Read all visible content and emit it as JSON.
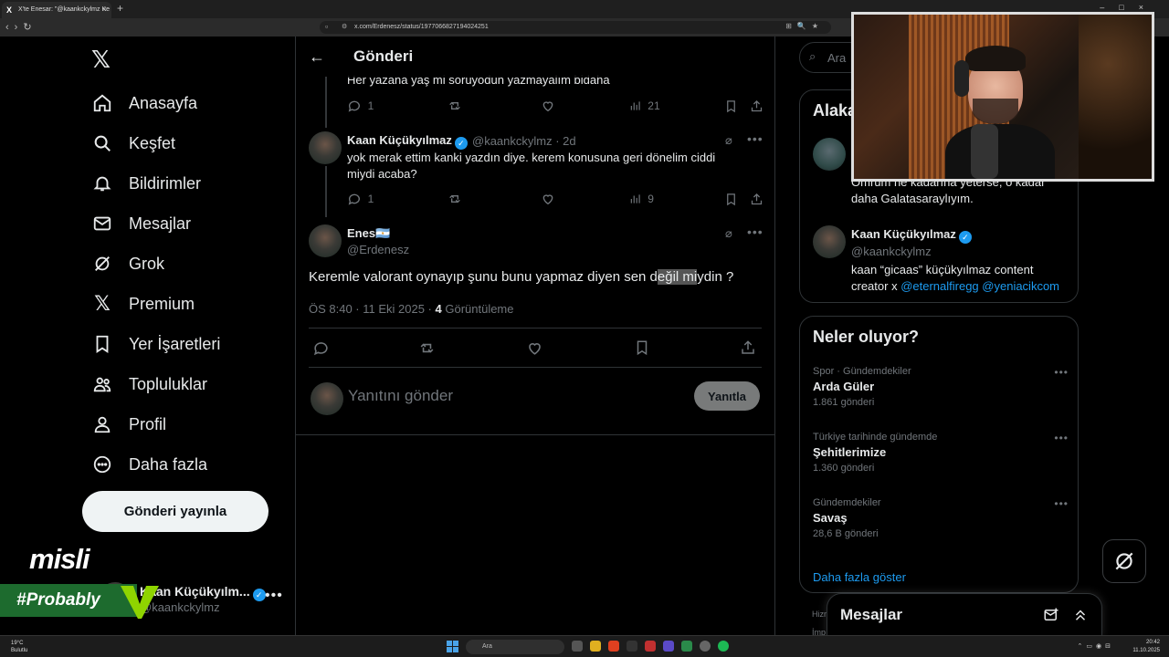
{
  "browser": {
    "tab_title": "X'te Enesar: \"@kaankckylmz Ke",
    "url": "x.com/Erdenesz/status/1977066827194024251"
  },
  "sidebar": {
    "items": [
      {
        "label": "Anasayfa",
        "icon": "home-icon"
      },
      {
        "label": "Keşfet",
        "icon": "search-icon"
      },
      {
        "label": "Bildirimler",
        "icon": "bell-icon"
      },
      {
        "label": "Mesajlar",
        "icon": "mail-icon"
      },
      {
        "label": "Grok",
        "icon": "grok-icon"
      },
      {
        "label": "Premium",
        "icon": "x-icon"
      },
      {
        "label": "Yer İşaretleri",
        "icon": "bookmark-icon"
      },
      {
        "label": "Topluluklar",
        "icon": "people-icon"
      },
      {
        "label": "Profil",
        "icon": "person-icon"
      },
      {
        "label": "Daha fazla",
        "icon": "more-circle-icon"
      }
    ],
    "post_button": "Gönderi yayınla",
    "account": {
      "name": "Kaan Küçükyılm...",
      "handle": "@kaankckylmz"
    }
  },
  "overlay": {
    "brand": "misli",
    "hashtag": "#Probably"
  },
  "main": {
    "title": "Gönderi",
    "cut_text": "Her yazana yaş mi soruyodun yazmayalım bidaha",
    "first_actions": {
      "replies": "1",
      "retweets": "",
      "likes": "",
      "views": "21"
    },
    "reply": {
      "name": "Kaan Küçükyılmaz",
      "meta": "@kaankckylmz · 2d",
      "text": "yok merak ettim kanki yazdın diye. kerem konusuna geri dönelim ciddi miydi acaba?",
      "replies": "1",
      "views": "9"
    },
    "post": {
      "name": "Enes",
      "flag": "🇦🇷",
      "handle": "@Erdenesz",
      "text_before": "Keremle valorant oynayıp şunu bunu yapmaz diyen sen d",
      "text_highlight": "eğil mi",
      "text_after": "ydin ?",
      "timestamp": "ÖS 8:40 · 11 Eki 2025 · ",
      "views_count": "4",
      "views_label": " Görüntüleme"
    },
    "compose_placeholder": "Yanıtını gönder",
    "reply_button": "Yanıtla"
  },
  "right": {
    "search_placeholder": "Ara",
    "related_title": "Alaka",
    "related": [
      {
        "bio": "Ömrüm ne kadarına yeterse, o kadar daha Galatasaraylıyım."
      },
      {
        "name": "Kaan Küçükyılmaz",
        "handle": "@kaankckylmz",
        "bio_text": "kaan “gicaas” küçükyılmaz content creator x ",
        "link1": "@eternalfiregg",
        "link2": "@yeniacikcom"
      }
    ],
    "trends_title": "Neler oluyor?",
    "trends": [
      {
        "category": "Spor · Gündemdekiler",
        "title": "Arda Güler",
        "count": "1.861 gönderi"
      },
      {
        "category": "Türkiye tarihinde gündemde",
        "title": "Şehitlerimize",
        "count": "1.360 gönderi"
      },
      {
        "category": "Gündemdekiler",
        "title": "Savaş",
        "count": "28,6 B gönderi"
      }
    ],
    "show_more": "Daha fazla göster",
    "messages_drawer": "Mesajlar",
    "hint1": "Hizm",
    "hint2": "İmp"
  },
  "taskbar": {
    "weather_temp": "19°C",
    "weather_desc": "Bulutlu",
    "search": "Ara",
    "time": "20:42",
    "date": "11.10.2025"
  },
  "colors": {
    "accent": "#1d9bf0",
    "background": "#000000",
    "text": "#e7e9ea",
    "muted": "#71767b",
    "green": "#1d6b2e"
  }
}
